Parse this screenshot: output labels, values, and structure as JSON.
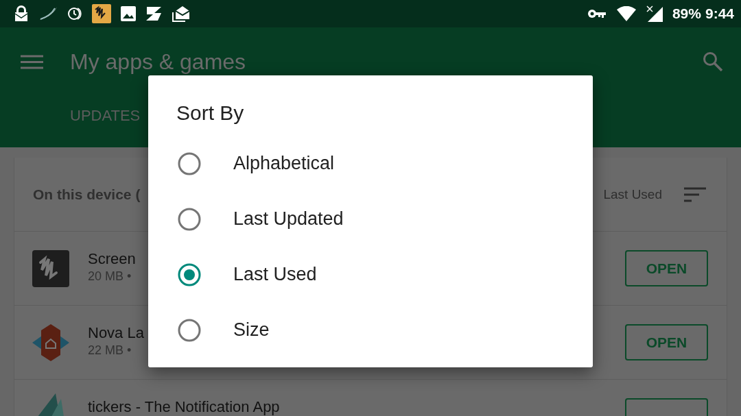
{
  "status_bar": {
    "battery": "89%",
    "time": "9:44"
  },
  "toolbar": {
    "title": "My apps & games",
    "tabs": [
      {
        "label": "UPDATES",
        "selected": false
      }
    ]
  },
  "list_header": {
    "title": "On this device (",
    "sort_label": "Last Used"
  },
  "apps": [
    {
      "kind": "scribble",
      "name": "Screen",
      "meta": "20 MB •",
      "button": "OPEN"
    },
    {
      "kind": "house",
      "name": "Nova La",
      "meta": "22 MB •",
      "button": "OPEN"
    },
    {
      "kind": "wing",
      "name": "tickers - The Notification App"
    }
  ],
  "dialog": {
    "title": "Sort By",
    "options": [
      {
        "label": "Alphabetical",
        "selected": false
      },
      {
        "label": "Last Updated",
        "selected": false
      },
      {
        "label": "Last Used",
        "selected": true
      },
      {
        "label": "Size",
        "selected": false
      }
    ]
  }
}
